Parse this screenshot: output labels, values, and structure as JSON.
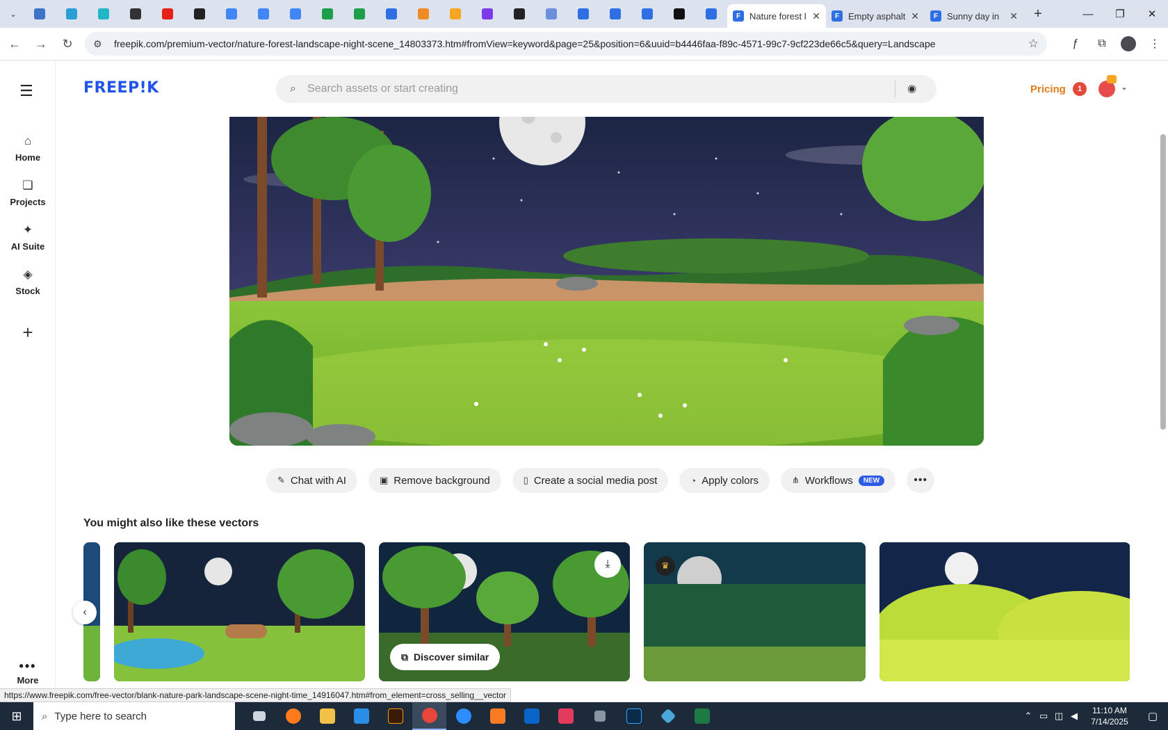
{
  "browser": {
    "tabs": [
      {
        "title": "Nature forest landscape night scene",
        "active": true
      },
      {
        "title": "Empty asphalt road",
        "active": false
      },
      {
        "title": "Sunny day in",
        "active": false
      }
    ],
    "pinned_favicon_colors": [
      "#3d73c9",
      "#2a9fd6",
      "#20b6c5",
      "#333333",
      "#e62117",
      "#222222",
      "#4285f4",
      "#4285f4",
      "#4285f4",
      "#1e9e4a",
      "#1e9e4a",
      "#2f6fe4",
      "#f08a24",
      "#f5a623",
      "#7c3aed",
      "#222222",
      "#6b8fd8",
      "#2f6fe4",
      "#2f6fe4",
      "#2f6fe4",
      "#111111",
      "#2f6fe4"
    ],
    "address": "freepik.com/premium-vector/nature-forest-landscape-night-scene_14803373.htm#fromView=keyword&page=25&position=6&uuid=b4446faa-f89c-4571-99c7-9cf223de66c5&query=Landscape",
    "status_url": "https://www.freepik.com/free-vector/blank-nature-park-landscape-scene-night-time_14916047.htm#from_element=cross_selling__vector"
  },
  "sidebar": {
    "items": [
      {
        "label": "Home",
        "icon": "home-icon"
      },
      {
        "label": "Projects",
        "icon": "projects-icon"
      },
      {
        "label": "AI Suite",
        "icon": "sparkle-icon"
      },
      {
        "label": "Stock",
        "icon": "stock-icon"
      }
    ],
    "more_label": "More"
  },
  "header": {
    "logo": "FREEP!K",
    "search_placeholder": "Search assets or start creating",
    "pricing": "Pricing",
    "notification_count": "1"
  },
  "actions": [
    {
      "label": "Chat with AI",
      "icon": "chat-icon"
    },
    {
      "label": "Remove background",
      "icon": "remove-bg-icon"
    },
    {
      "label": "Create a social media post",
      "icon": "phone-icon"
    },
    {
      "label": "Apply colors",
      "icon": "palette-icon"
    },
    {
      "label": "Workflows",
      "icon": "workflow-icon",
      "badge": "NEW"
    }
  ],
  "related": {
    "title": "You might also like these vectors",
    "discover_label": "Discover similar"
  },
  "taskbar": {
    "search_placeholder": "Type here to search",
    "time": "11:10 AM",
    "date": "7/14/2025"
  },
  "colors": {
    "brand": "#1f54e8",
    "pricing": "#e07b1a",
    "new_badge": "#2d5be3"
  }
}
